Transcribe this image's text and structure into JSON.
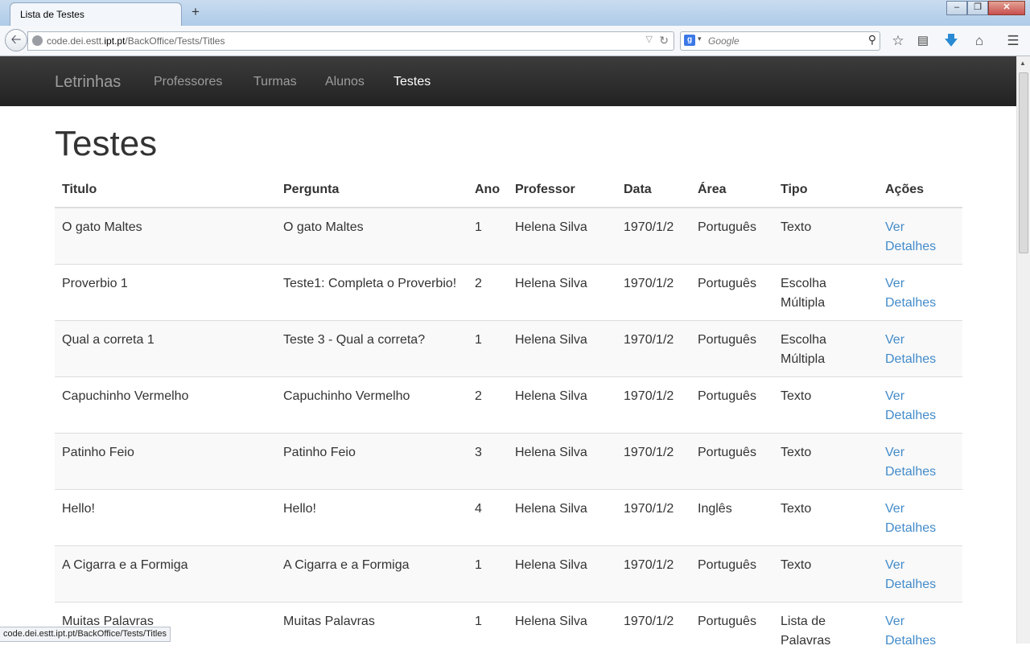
{
  "browser": {
    "tab_title": "Lista de Testes",
    "new_tab_symbol": "+",
    "url_domain_prefix": "code.dei.estt.",
    "url_domain_bold": "ipt.pt",
    "url_path": "/BackOffice/Tests/Titles",
    "search_placeholder": "Google",
    "status_url": "code.dei.estt.ipt.pt/BackOffice/Tests/Titles"
  },
  "app": {
    "brand": "Letrinhas",
    "nav": [
      {
        "label": "Professores",
        "active": false
      },
      {
        "label": "Turmas",
        "active": false
      },
      {
        "label": "Alunos",
        "active": false
      },
      {
        "label": "Testes",
        "active": true
      }
    ]
  },
  "page": {
    "title": "Testes",
    "columns": [
      "Titulo",
      "Pergunta",
      "Ano",
      "Professor",
      "Data",
      "Área",
      "Tipo",
      "Ações"
    ],
    "rows": [
      {
        "titulo": "O gato Maltes",
        "pergunta": "O gato Maltes",
        "ano": "1",
        "professor": "Helena Silva",
        "data": "1970/1/2",
        "area": "Português",
        "tipo": "Texto",
        "acao": "Ver Detalhes"
      },
      {
        "titulo": "Proverbio 1",
        "pergunta": "Teste1: Completa o Proverbio!",
        "ano": "2",
        "professor": "Helena Silva",
        "data": "1970/1/2",
        "area": "Português",
        "tipo": "Escolha Múltipla",
        "acao": "Ver Detalhes"
      },
      {
        "titulo": "Qual a correta 1",
        "pergunta": "Teste 3 - Qual a correta?",
        "ano": "1",
        "professor": "Helena Silva",
        "data": "1970/1/2",
        "area": "Português",
        "tipo": "Escolha Múltipla",
        "acao": "Ver Detalhes"
      },
      {
        "titulo": "Capuchinho Vermelho",
        "pergunta": "Capuchinho Vermelho",
        "ano": "2",
        "professor": "Helena Silva",
        "data": "1970/1/2",
        "area": "Português",
        "tipo": "Texto",
        "acao": "Ver Detalhes"
      },
      {
        "titulo": "Patinho Feio",
        "pergunta": "Patinho Feio",
        "ano": "3",
        "professor": "Helena Silva",
        "data": "1970/1/2",
        "area": "Português",
        "tipo": "Texto",
        "acao": "Ver Detalhes"
      },
      {
        "titulo": "Hello!",
        "pergunta": "Hello!",
        "ano": "4",
        "professor": "Helena Silva",
        "data": "1970/1/2",
        "area": "Inglês",
        "tipo": "Texto",
        "acao": "Ver Detalhes"
      },
      {
        "titulo": "A Cigarra e a Formiga",
        "pergunta": "A Cigarra e a Formiga",
        "ano": "1",
        "professor": "Helena Silva",
        "data": "1970/1/2",
        "area": "Português",
        "tipo": "Texto",
        "acao": "Ver Detalhes"
      },
      {
        "titulo": "Muitas Palavras",
        "pergunta": "Muitas Palavras",
        "ano": "1",
        "professor": "Helena Silva",
        "data": "1970/1/2",
        "area": "Português",
        "tipo": "Lista de Palavras",
        "acao": "Ver Detalhes"
      }
    ]
  },
  "colors": {
    "navbar_bg": "#222222",
    "nav_active": "#ffffff",
    "nav_inactive": "#9d9d9d",
    "link": "#428bca",
    "row_stripe": "#f9f9f9"
  }
}
